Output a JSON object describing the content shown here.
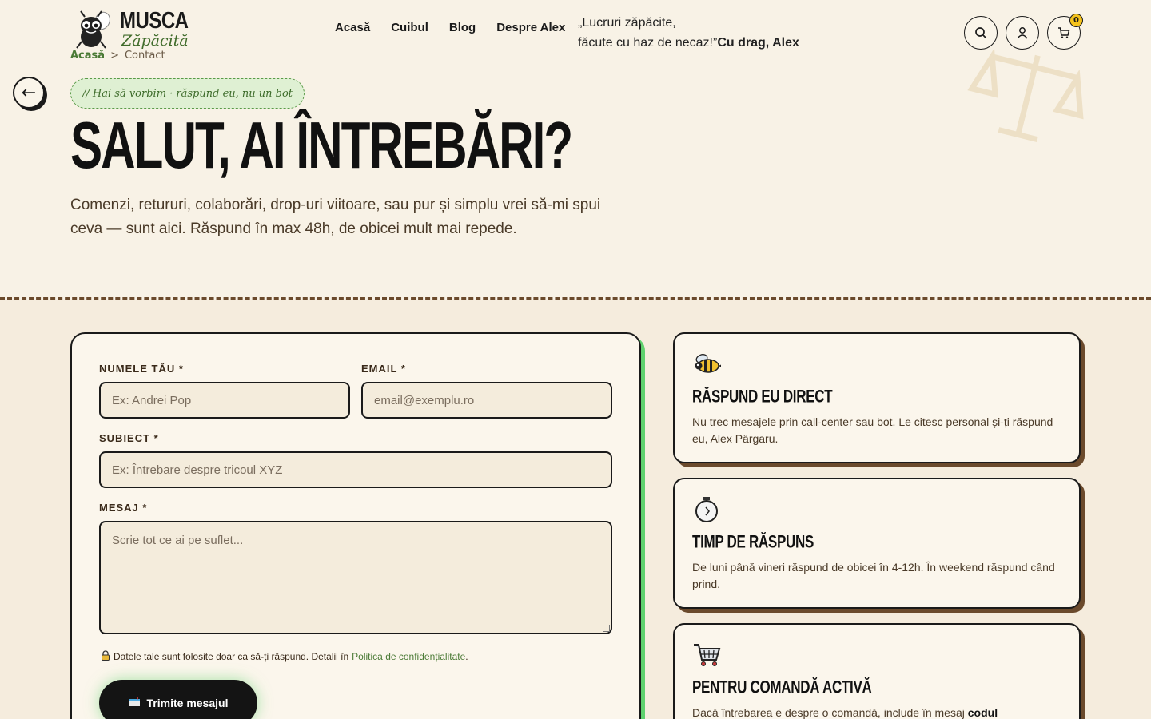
{
  "header": {
    "logo": {
      "line1": "MUSCA",
      "line2": "Zăpăcită"
    },
    "breadcrumb": {
      "home": "Acasă",
      "separator": ">",
      "current": "Contact"
    },
    "nav": [
      "Acasă",
      "Cuibul",
      "Blog",
      "Despre Alex"
    ],
    "tagline": {
      "line1": "„Lucruri zăpăcite,",
      "line2": "făcute cu haz de necaz!”",
      "signature": "Cu drag, Alex"
    },
    "cart_count": "0"
  },
  "hero": {
    "pill": "// Hai să vorbim · răspund eu, nu un bot",
    "title": "SALUT, AI ÎNTREBĂRI?",
    "description": "Comenzi, retururi, colaborări, drop-uri viitoare, sau pur și simplu vrei să-mi spui ceva — sunt aici. Răspund în max 48h, de obicei mult mai repede."
  },
  "form": {
    "name_label": "NUMELE TĂU *",
    "name_placeholder": "Ex: Andrei Pop",
    "email_label": "EMAIL *",
    "email_placeholder": "email@exemplu.ro",
    "subject_label": "SUBIECT *",
    "subject_placeholder": "Ex: Întrebare despre tricoul XYZ",
    "message_label": "MESAJ *",
    "message_placeholder": "Scrie tot ce ai pe suflet...",
    "privacy_text": "Datele tale sunt folosite doar ca să-ți răspund. Detalii în",
    "privacy_link": "Politica de confidențialitate",
    "privacy_end": ".",
    "submit_label": "Trimite mesajul"
  },
  "info_cards": [
    {
      "icon": "bee-icon",
      "title": "RĂSPUND EU DIRECT",
      "text": "Nu trec mesajele prin call-center sau bot. Le citesc personal și-ți răspund eu, Alex Pârgaru."
    },
    {
      "icon": "stopwatch-icon",
      "title": "TIMP DE RĂSPUNS",
      "text": "De luni până vineri răspund de obicei în 4-12h. În weekend răspund când prind."
    },
    {
      "icon": "cart-icon",
      "title": "PENTRU COMANDĂ ACTIVĂ",
      "text": "Dacă întrebarea e despre o comandă, include în mesaj",
      "text_bold": "codul"
    }
  ],
  "colors": {
    "background": "#f8f2e6",
    "accent_green": "#5fd16e",
    "brand_green": "#4a7a35",
    "badge_yellow": "#f4c21c",
    "shadow_brown": "#6b4a2c"
  }
}
